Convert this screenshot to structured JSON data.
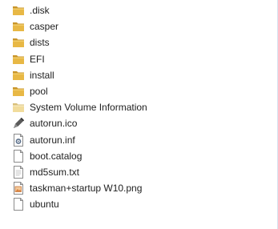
{
  "files": [
    {
      "name": ".disk",
      "icon": "folder-icon",
      "type": "folder"
    },
    {
      "name": "casper",
      "icon": "folder-icon",
      "type": "folder"
    },
    {
      "name": "dists",
      "icon": "folder-icon",
      "type": "folder"
    },
    {
      "name": "EFI",
      "icon": "folder-icon",
      "type": "folder"
    },
    {
      "name": "install",
      "icon": "folder-icon",
      "type": "folder"
    },
    {
      "name": "pool",
      "icon": "folder-icon",
      "type": "folder"
    },
    {
      "name": "System Volume Information",
      "icon": "locked-folder-icon",
      "type": "folder-system"
    },
    {
      "name": "autorun.ico",
      "icon": "pen-icon",
      "type": "ico"
    },
    {
      "name": "autorun.inf",
      "icon": "settings-file-icon",
      "type": "inf"
    },
    {
      "name": "boot.catalog",
      "icon": "blank-file-icon",
      "type": "file"
    },
    {
      "name": "md5sum.txt",
      "icon": "text-file-icon",
      "type": "txt"
    },
    {
      "name": "taskman+startup W10.png",
      "icon": "image-file-icon",
      "type": "png"
    },
    {
      "name": "ubuntu",
      "icon": "blank-file-icon",
      "type": "file"
    }
  ],
  "colors": {
    "folder": "#e8b845",
    "folder_dark": "#c9952a",
    "folder_faded": "#f1dc9c",
    "text": "#1e1e1e",
    "hover": "#e5f3fb"
  }
}
